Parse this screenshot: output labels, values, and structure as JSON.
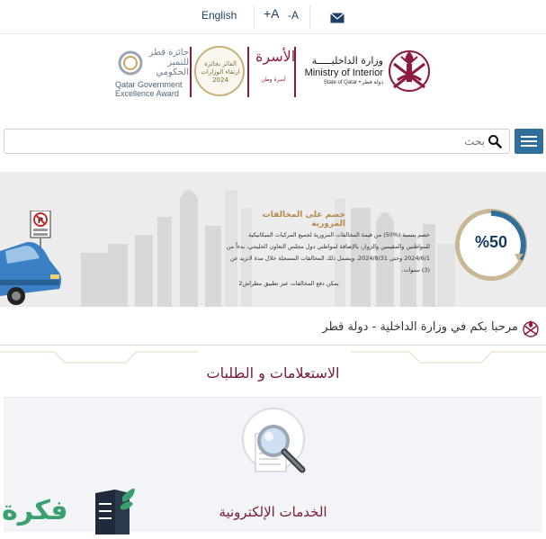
{
  "topbar": {
    "language_label": "English",
    "font_increase_label": "+A",
    "font_decrease_label": "-A",
    "icons": {
      "mail": "mail-icon"
    }
  },
  "logos": {
    "excellence_award_ar": "جائزة قطر للتميز الحكومي",
    "excellence_award_en_line1": "Qatar Government",
    "excellence_award_en_line2": "Excellence Award",
    "badge_2024_text": "الفائز بجائزة ارتقاء الوزارات",
    "badge_2024_year": "2024",
    "usra_name": "الأسرة",
    "usra_sub": "أسرة وطن",
    "moi_ar": "وزارة الداخليـــــة",
    "moi_en": "Ministry of Interior",
    "moi_sub": "State of Qatar • دولة قطر"
  },
  "search": {
    "placeholder": "بحث"
  },
  "banner": {
    "title": "خصم على المخالفات المرورية",
    "body": "خصم بنسبة (%50) من قيمة المخالفات المرورية لجميع المركبات الميكانيكية للمواطنين والمقيمين والزوار، بالإضافة لمواطني دول مجلس التعاون الخليجي، بدءاً من 2024/6/1 وحتى 2024/8/31، ويشمل ذلك المخالفات المسجلة خلال مدة لاتزيد عن (3) سنوات.",
    "link": "يمكن دفع المخالفات عبر تطبيق مطراش2",
    "discount": "%50",
    "colors": {
      "gold": "#c9b796",
      "navy": "#163a5c"
    }
  },
  "welcome": {
    "text": "مرحبا بكم في وزارة الداخلية - دولة قطر"
  },
  "sections": {
    "inquiries_title": "الاستعلامات و الطلبات",
    "eservices_title": "الخدمات الإلكترونية"
  },
  "watermark": {
    "text": "فكرة"
  },
  "colors": {
    "maroon": "#7a1a33",
    "menu_blue": "#2f6f9a"
  }
}
